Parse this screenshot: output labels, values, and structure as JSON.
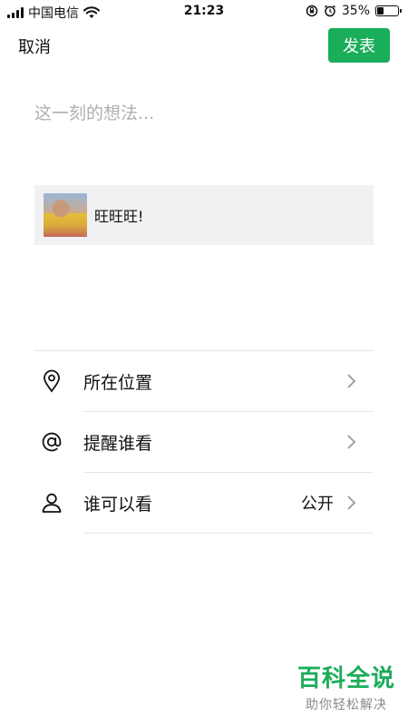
{
  "status_bar": {
    "carrier": "中国电信",
    "time": "21:23",
    "battery": "35%",
    "battery_level": 0.35
  },
  "header": {
    "cancel_label": "取消",
    "publish_label": "发表"
  },
  "compose": {
    "placeholder": "这一刻的想法..."
  },
  "link_card": {
    "title": "旺旺旺!"
  },
  "options": {
    "location_label": "所在位置",
    "mention_label": "提醒谁看",
    "visibility_label": "谁可以看",
    "visibility_value": "公开"
  },
  "watermark": {
    "title": "百科全说",
    "subtitle": "助你轻松解决"
  },
  "colors": {
    "accent": "#1aad5a",
    "card_bg": "#f1f1f3",
    "divider": "#e6e6e6"
  }
}
